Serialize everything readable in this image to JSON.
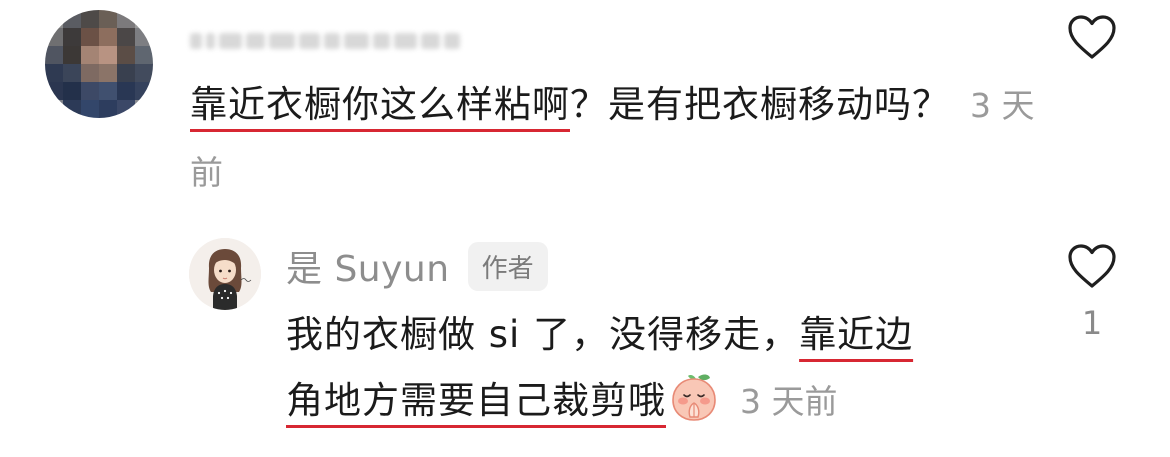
{
  "comment": {
    "text_underlined": "靠近衣橱你这么样粘啊",
    "text_rest": "？是有把衣橱移动吗？",
    "time": "3 天前"
  },
  "reply": {
    "username": "是 Suyun",
    "author_badge": "作者",
    "text_plain": "我的衣橱做 si 了，没得移走，",
    "text_underlined_1": "靠近边",
    "text_underlined_2": "角地方需要自己裁剪哦",
    "emoji": "praying-peach-emoji",
    "time": "3 天前",
    "like_count": "1"
  },
  "icons": {
    "like": "heart-outline-icon"
  },
  "colors": {
    "underline": "#d72732",
    "meta_text": "#9a9a9a",
    "badge_bg": "#f1f1f1"
  }
}
